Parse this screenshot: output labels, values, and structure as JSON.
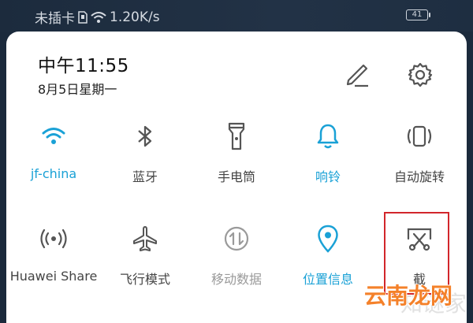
{
  "status_bar": {
    "carrier": "未插卡",
    "speed": "1.20K/s",
    "battery": "41"
  },
  "header": {
    "time": "中午11:55",
    "date": "8月5日星期一",
    "edit_icon": "pencil-icon",
    "settings_icon": "gear-icon"
  },
  "tiles": [
    {
      "label": "jf-china",
      "icon": "wifi-icon",
      "state": "on"
    },
    {
      "label": "蓝牙",
      "icon": "bluetooth-icon",
      "state": "off"
    },
    {
      "label": "手电筒",
      "icon": "flashlight-icon",
      "state": "off"
    },
    {
      "label": "响铃",
      "icon": "bell-icon",
      "state": "on"
    },
    {
      "label": "自动旋转",
      "icon": "rotate-icon",
      "state": "off"
    },
    {
      "label": "Huawei Share",
      "icon": "share-icon",
      "state": "off"
    },
    {
      "label": "飞行模式",
      "icon": "airplane-icon",
      "state": "off"
    },
    {
      "label": "移动数据",
      "icon": "mobile-data-icon",
      "state": "disabled"
    },
    {
      "label": "位置信息",
      "icon": "location-icon",
      "state": "on"
    },
    {
      "label": "截",
      "icon": "screenshot-icon",
      "state": "off"
    }
  ],
  "watermark": {
    "faint": "知谜家",
    "brand": "云南龙网"
  },
  "colors": {
    "accent": "#1aa1d6",
    "icon": "#555555",
    "disabled": "#9a9a9a",
    "highlight": "#d2262b",
    "watermark": "#f4812a"
  }
}
